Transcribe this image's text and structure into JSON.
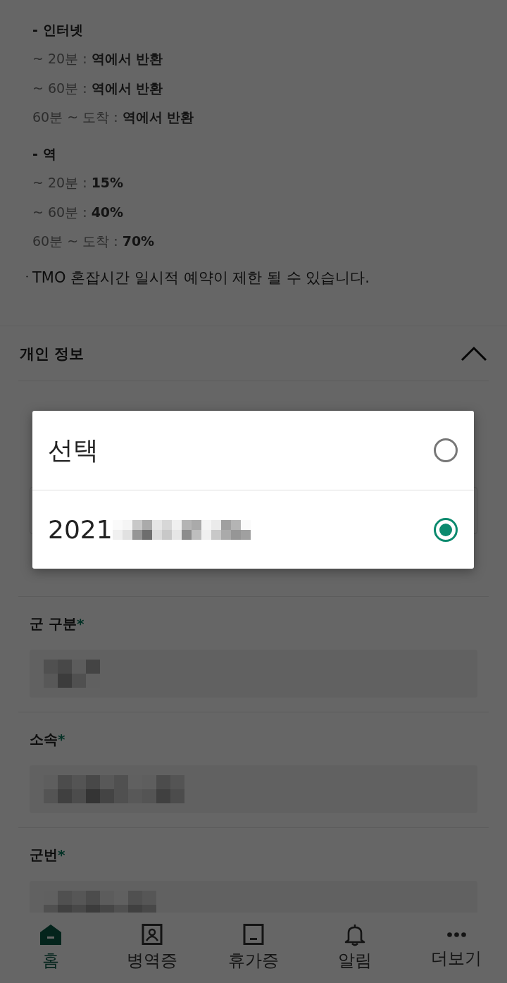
{
  "info": {
    "groups": [
      {
        "heading": "- 인터넷",
        "lines": [
          "~ 20분 : **역에서 반환**",
          "~ 60분 : **역에서 반환**",
          "60분 ~ 도착 : **역에서 반환**"
        ]
      },
      {
        "heading": "- 역",
        "lines": [
          "~ 20분 : **15%**",
          "~ 60분 : **40%**",
          "60분 ~ 도착 : **70%**"
        ]
      }
    ],
    "note": {
      "bullet": "ㆍ",
      "text": "TMO 혼잡시간 일시적 예약이 제한 될 수 있습니다."
    }
  },
  "section": {
    "title": "개인 정보",
    "expanded": true
  },
  "fields": [
    {
      "label": "군 구분",
      "required_mark": "*"
    },
    {
      "label": "소속",
      "required_mark": "*"
    },
    {
      "label": "군번",
      "required_mark": "*"
    }
  ],
  "dialog": {
    "options": [
      {
        "label": "선택",
        "selected": false
      },
      {
        "label": "2021",
        "selected": true
      }
    ]
  },
  "nav": [
    {
      "label": "홈",
      "kind": "home",
      "selected": true
    },
    {
      "label": "병역증",
      "kind": "id",
      "selected": false
    },
    {
      "label": "휴가증",
      "kind": "pass",
      "selected": false
    },
    {
      "label": "알림",
      "kind": "bell",
      "selected": false
    },
    {
      "label": "더보기",
      "kind": "more",
      "selected": false
    }
  ]
}
